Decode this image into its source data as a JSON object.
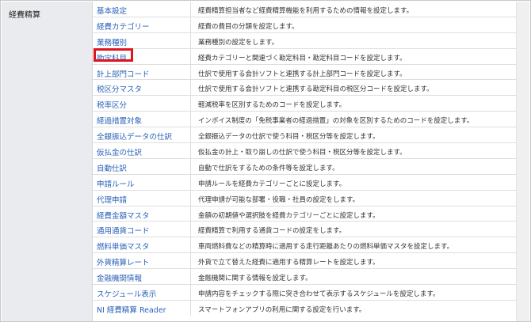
{
  "category": {
    "label": "経費精算"
  },
  "highlight_color": "#e0141d",
  "link_color": "#2a62b8",
  "items": [
    {
      "label": "基本設定",
      "desc": "経費精算担当者など経費精算機能を利用するための情報を設定します。"
    },
    {
      "label": "経費カテゴリー",
      "desc": "経費の費目の分類を設定します。"
    },
    {
      "label": "業務種別",
      "desc": "業務種別の設定をします。"
    },
    {
      "label": "勘定科目",
      "desc": "経費カテゴリーと関連づく勘定科目・勘定科目コードを設定します。",
      "highlighted": true
    },
    {
      "label": "計上部門コード",
      "desc": "仕訳で使用する会計ソフトと連携する計上部門コードを設定します。"
    },
    {
      "label": "税区分マスタ",
      "desc": "仕訳で使用する会計ソフトと連携する勘定科目の税区分コードを設定します。"
    },
    {
      "label": "税率区分",
      "desc": "軽減税率を区別するためのコードを設定します。"
    },
    {
      "label": "経過措置対象",
      "desc": "インボイス制度の「免税事業者の経過措置」の対象を区別するためのコードを設定します。"
    },
    {
      "label": "全銀振込データの仕訳",
      "desc": "全銀振込データの仕訳で使う科目・税区分等を設定します。"
    },
    {
      "label": "仮払金の仕訳",
      "desc": "仮払金の計上・取り崩しの仕訳で使う科目・税区分等を設定します。"
    },
    {
      "label": "自動仕訳",
      "desc": "自動で仕訳をするための条件等を設定します。"
    },
    {
      "label": "申請ルール",
      "desc": "申請ルールを経費カテゴリーごとに設定します。"
    },
    {
      "label": "代理申請",
      "desc": "代理申請が可能な部署・役職・社員の設定をします。"
    },
    {
      "label": "経費金額マスタ",
      "desc": "金額の初期値や選択肢を経費カテゴリーごとに設定します。"
    },
    {
      "label": "通用通貨コード",
      "desc": "経費精算で利用する通貨コードの設定をします。"
    },
    {
      "label": "燃料単価マスタ",
      "desc": "車両燃料費などの精算時に適用する走行距離あたりの燃料単価マスタを設定します。"
    },
    {
      "label": "外貨精算レート",
      "desc": "外貨で立て替えた経費に適用する精算レートを設定します。"
    },
    {
      "label": "金融機関情報",
      "desc": "金融機関に関する情報を設定します。"
    },
    {
      "label": "スケジュール表示",
      "desc": "申請内容をチェックする際に突き合わせて表示するスケジュールを設定します。"
    },
    {
      "label": "NI 経費精算 Reader",
      "desc": "スマートフォンアプリの利用に関する設定を行います。"
    }
  ]
}
